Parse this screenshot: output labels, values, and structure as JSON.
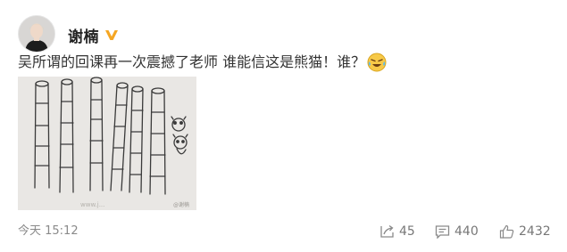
{
  "user": {
    "name": "谢楠",
    "verified_icon": "verified-badge-icon",
    "verified_color": "#f5a623"
  },
  "post": {
    "text": "吴所谓的回课再一次震撼了老师 谁能信这是熊猫！谁？",
    "emoji_icon": "laughing-tears-emoji-icon",
    "image_description_icon": "child-drawing-image"
  },
  "footer": {
    "timestamp": "今天 15:12",
    "reposts": "45",
    "comments": "440",
    "likes": "2432"
  },
  "colors": {
    "text_primary": "#333333",
    "text_muted": "#8a8a8a",
    "accent_verified": "#f5a623"
  }
}
